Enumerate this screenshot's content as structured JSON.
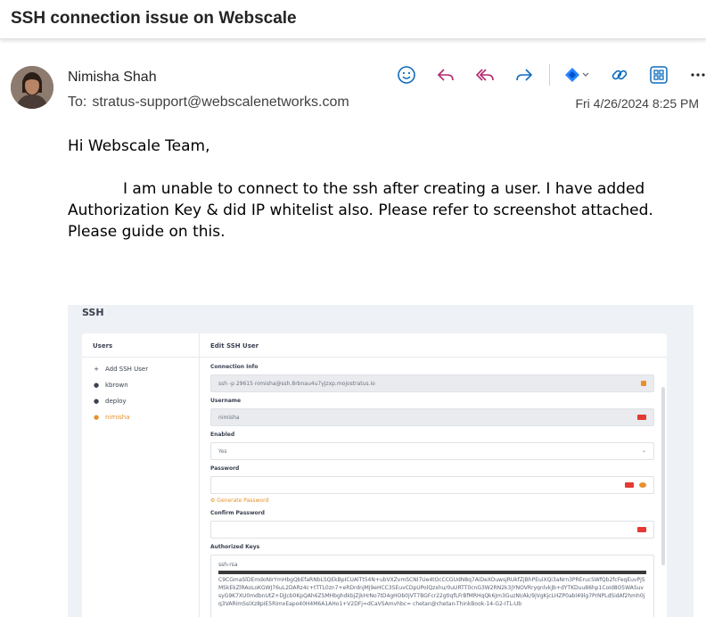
{
  "email": {
    "subject": "SSH connection issue on Webscale",
    "sender_name": "Nimisha Shah",
    "to_label": "To:",
    "to_address": "stratus-support@webscalenetworks.com",
    "date": "Fri 4/26/2024 8:25 PM",
    "actions": [
      "smile-icon",
      "reply-icon",
      "reply-all-icon",
      "forward-icon",
      "jira-icon",
      "link-icon",
      "apps-icon",
      "more-icon"
    ],
    "greeting": "Hi Webscale Team,",
    "body": "I am unable to connect to the ssh after creating a user. I have added Authorization Key & did IP whitelist also. Please refer to screenshot attached. Please guide on this.",
    "colors": {
      "accent": "#0f6cbd",
      "action_icon": "#0f6cbd",
      "jira": "#2684ff"
    }
  },
  "screenshot": {
    "title": "SSH",
    "users_header": "Users",
    "add_user": "Add SSH User",
    "users": [
      "kbrown",
      "deploy",
      "nimisha"
    ],
    "active_user": "nimisha",
    "edit_header": "Edit SSH User",
    "connection_label": "Connection Info",
    "connection_value": "ssh -p 29615 nimisha@ssh.8rbnau4u7yjzxp.mojostratus.io",
    "username_label": "Username",
    "username_value": "nimisha",
    "enabled_label": "Enabled",
    "enabled_value": "Yes",
    "password_label": "Password",
    "generate_label": "Generate Password",
    "confirm_label": "Confirm Password",
    "keys_label": "Authorized Keys",
    "keys_prefix": "ssh-rsa",
    "keys_value": "C9CGmaSlDEmdoNIrYmHbgQbEfaRNbLSQEkBpICUAlTt54N+ubVXZvmSCNI7Ue4tOcCCGUdN8q7AiDeXOuwsjRUkfZjBhPEuiXQi3aNrn3PRErucSWfQb2fcFeqEuvPjSMSkEkZlRAoLoKGWJ76uL2DARz4c+tTTL0zn7+eRDrdnjMj9eHCC3SEuvCDpUPolQzxhu/0uURTT0cnG3W2RN2k3jYNOVRryqnlvkJb+dYTKDuu86hp1CoId8O5WASuvsyG9K7XU0mdbnUtZ+DjJcb0KpQAh6ZSMHbghdkbjZjkHrNo7tD4gHOb0jVT7BGFcr22gtIqfLFrBfMRHqQk6Jm3GuzNI/Ak/9jVgKjcLHZP0abl49lg7PrNPLdSidAf2hmh0jq3VARimSsIXz8pIE5RimxEapo40H4M6A1AHo1+V2DFj=dCaVSAmvhbc= chetan@chetan-ThinkBook-14-G2-ITL-Ub"
  }
}
